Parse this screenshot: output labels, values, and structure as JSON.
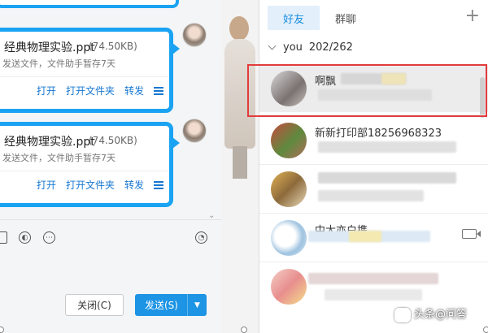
{
  "chat": {
    "messages": [
      {
        "file_name": "经典物理实验.ppt",
        "file_size": "(74.50KB)",
        "note": "发送文件，文件助手暂存7天"
      },
      {
        "file_name": "经典物理实验.ppt",
        "file_size": "(74.50KB)",
        "note": "发送文件，文件助手暂存7天"
      }
    ],
    "actions": {
      "open": "打开",
      "open_folder": "打开文件夹",
      "forward": "转发"
    },
    "buttons": {
      "close": "关闭(C)",
      "send": "发送(S)"
    }
  },
  "contacts": {
    "tabs": {
      "friends": "好友",
      "groups": "群聊"
    },
    "group": {
      "name": "you",
      "count": "202/262"
    },
    "items": [
      {
        "name": "啊飘"
      },
      {
        "name": "新新打印部18256968323"
      },
      {
        "name": ""
      },
      {
        "name": "中大亦白携"
      },
      {
        "name": ""
      }
    ]
  },
  "watermark": "头条@问答",
  "colors": {
    "accent": "#1aa3f2",
    "send_button": "#1d94e4",
    "selection_outline": "#e33b3b",
    "active_tab_bg": "#e3f0fb"
  }
}
